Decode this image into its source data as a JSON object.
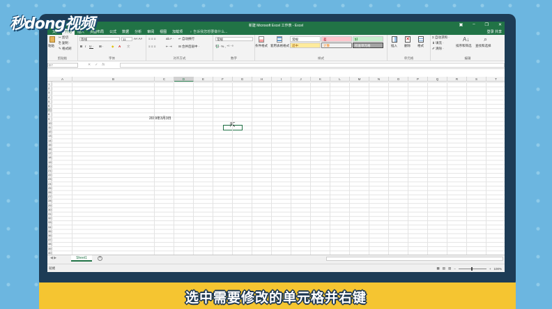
{
  "watermark": "秒dong视频",
  "caption": "选中需要修改的单元格并右键",
  "excel": {
    "window_title": "新建 Microsoft Excel 工作表 - Excel",
    "tabs": [
      "文件",
      "开始",
      "插入",
      "页面布局",
      "公式",
      "数据",
      "审阅",
      "视图",
      "加载项"
    ],
    "tab_extra": [
      "分析"
    ],
    "tell_me": "告诉我您想要做什么...",
    "login": "登录  共享",
    "ribbon": {
      "paste": "粘贴",
      "cut": "剪切",
      "copy": "复制 ·",
      "format_painter": "格式刷",
      "clipboard_label": "剪贴板",
      "font_name": "等线",
      "font_size": "11",
      "font_label": "字体",
      "wrap_text": "自动换行",
      "merge_center": "合并后居中 ·",
      "align_label": "对齐方式",
      "number_format": "常规",
      "number_label": "数字",
      "cond_format": "条件格式",
      "table_format": "套用表格格式",
      "style_normal": "常规",
      "style_bad": "差",
      "style_good": "好",
      "style_neutral": "适中",
      "style_calc": "计算",
      "style_check": "检查单元格",
      "styles_label": "样式",
      "insert": "插入",
      "delete": "删除",
      "format": "格式",
      "cells_label": "单元格",
      "autosum": "自动求和 ·",
      "fill": "填充 ·",
      "clear": "清除 ·",
      "sort_filter": "排序和筛选",
      "find_select": "查找和选择",
      "editing_label": "编辑"
    },
    "name_box": "D7",
    "fx": "fx",
    "columns": [
      "A",
      "B",
      "C",
      "D",
      "E",
      "F",
      "G",
      "H",
      "I",
      "J",
      "K",
      "L",
      "M",
      "N",
      "O",
      "P",
      "Q",
      "R",
      "S",
      "T"
    ],
    "selected_column": "D",
    "rows": [
      "1",
      "2",
      "3",
      "4",
      "5",
      "6",
      "7",
      "8",
      "9",
      "10",
      "11",
      "12",
      "13",
      "14",
      "15",
      "16",
      "17",
      "18",
      "19",
      "20",
      "21",
      "22",
      "23",
      "24",
      "25",
      "26",
      "27",
      "28",
      "29",
      "30",
      "31",
      "32",
      "33",
      "34",
      "35",
      "36",
      "37",
      "38",
      "39",
      "40"
    ],
    "selected_row": "7",
    "cell_b5": "2019年3月3日",
    "sheet_tab": "Sheet1",
    "status": "就绪",
    "zoom": "100%"
  }
}
